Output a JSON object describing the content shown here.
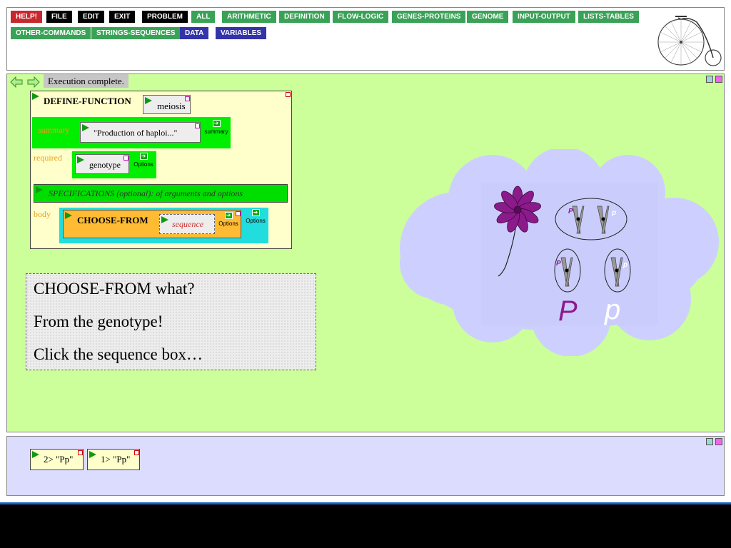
{
  "toolbar": {
    "row1": [
      "HELP!",
      "FILE",
      "EDIT",
      "EXIT",
      "PROBLEM",
      "ALL",
      "ARITHMETIC",
      "DEFINITION",
      "FLOW-LOGIC",
      "GENES-PROTEINS",
      "GENOME",
      "INPUT-OUTPUT",
      "LISTS-TABLES"
    ],
    "row2": [
      "OTHER-COMMANDS",
      "STRINGS-SEQUENCES",
      "DATA",
      "VARIABLES"
    ]
  },
  "workspace": {
    "status": "Execution complete.",
    "define": {
      "keyword": "DEFINE-FUNCTION",
      "name": "meiosis",
      "summary_label": "summary",
      "summary_value": "\"Production of haploi...\"",
      "summary_button": "summary",
      "required_label": "required",
      "required_value": "genotype",
      "options_label": "Options",
      "specifications": "SPECIFICATIONS (optional): of arguments and options",
      "body_label": "body",
      "choose_keyword": "CHOOSE-FROM",
      "choose_arg": "sequence"
    },
    "note": {
      "line1": "CHOOSE-FROM what?",
      "line2": "From the genotype!",
      "line3": "Click the sequence box…"
    },
    "illustration": {
      "allele_upper": "P",
      "allele_lower": "p",
      "chromosome_label_upper": "P",
      "chromosome_label_lower": "p",
      "colors": {
        "upper": "#8b1a8b",
        "lower": "#ffffff",
        "cloud": "#cdd0ff"
      }
    }
  },
  "output": {
    "results": [
      "2> \"Pp\"",
      "1> \"Pp\""
    ]
  },
  "colors": {
    "workspace_bg": "#ccff99",
    "output_bg": "#dcdcff",
    "define_bg": "#ffffcc",
    "green": "#00ee00",
    "orange": "#ffbb33",
    "cyan": "#22dddd"
  }
}
